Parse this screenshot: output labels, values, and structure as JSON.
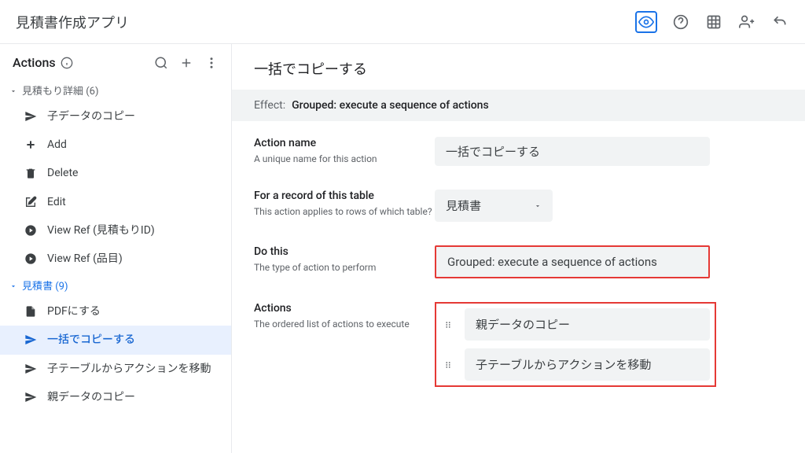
{
  "header": {
    "title": "見積書作成アプリ"
  },
  "sidebar": {
    "title": "Actions",
    "groups": [
      {
        "label": "見積もり詳細 (6)",
        "expanded": true,
        "color": "gray",
        "items": [
          {
            "icon": "send",
            "label": "子データのコピー"
          },
          {
            "icon": "plus",
            "label": "Add"
          },
          {
            "icon": "trash",
            "label": "Delete"
          },
          {
            "icon": "edit",
            "label": "Edit"
          },
          {
            "icon": "arrow-circle",
            "label": "View Ref (見積もりID)"
          },
          {
            "icon": "arrow-circle",
            "label": "View Ref (品目)"
          }
        ]
      },
      {
        "label": "見積書 (9)",
        "expanded": true,
        "color": "blue",
        "items": [
          {
            "icon": "file",
            "label": "PDFにする"
          },
          {
            "icon": "send",
            "label": "一括でコピーする",
            "selected": true
          },
          {
            "icon": "send",
            "label": "子テーブルからアクションを移動"
          },
          {
            "icon": "send",
            "label": "親データのコピー"
          }
        ]
      }
    ]
  },
  "main": {
    "title": "一括でコピーする",
    "effect": {
      "label": "Effect:",
      "value": "Grouped: execute a sequence of actions"
    },
    "fields": {
      "action_name": {
        "label": "Action name",
        "sub": "A unique name for this action",
        "value": "一括でコピーする"
      },
      "table": {
        "label": "For a record of this table",
        "sub": "This action applies to rows of which table?",
        "value": "見積書"
      },
      "do_this": {
        "label": "Do this",
        "sub": "The type of action to perform",
        "value": "Grouped: execute a sequence of actions"
      },
      "actions": {
        "label": "Actions",
        "sub": "The ordered list of actions to execute",
        "items": [
          "親データのコピー",
          "子テーブルからアクションを移動"
        ]
      }
    }
  }
}
